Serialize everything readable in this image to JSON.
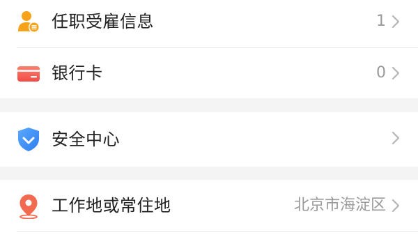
{
  "menu": {
    "employment": {
      "label": "任职受雇信息",
      "value": "1",
      "icon": "person-badge-icon"
    },
    "bank_card": {
      "label": "银行卡",
      "value": "0",
      "icon": "credit-card-icon"
    },
    "security": {
      "label": "安全中心",
      "value": "",
      "icon": "shield-check-icon"
    },
    "address": {
      "label": "工作地或常住地",
      "value": "北京市海淀区",
      "icon": "location-pin-icon"
    }
  },
  "colors": {
    "accent_orange": "#f7a21b",
    "card_red": "#f45a4f",
    "shield_blue": "#3b8cf5",
    "pin_red": "#f26a4f",
    "value_gray": "#9a9a9a",
    "section_gap": "#f4f4f5"
  }
}
